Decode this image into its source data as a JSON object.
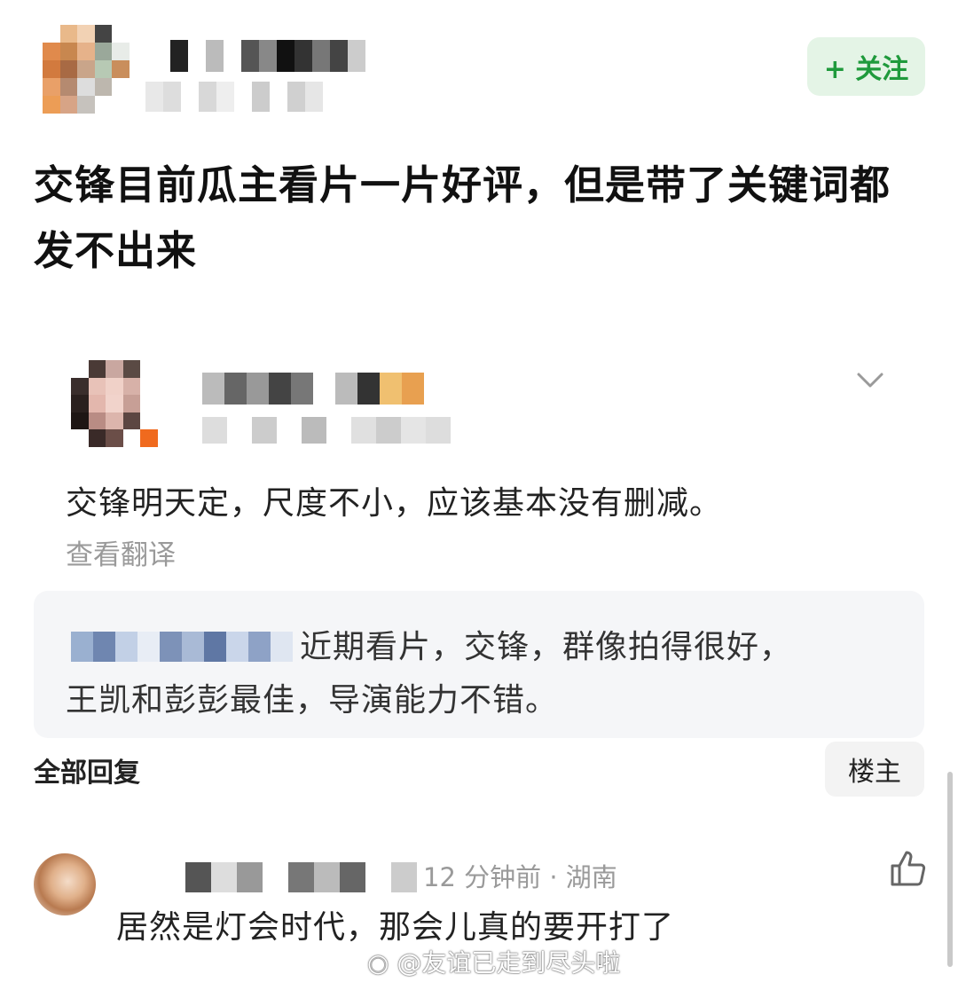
{
  "post": {
    "follow_label": "+ 关注",
    "title": "交锋目前瓜主看片一片好评，但是带了关键词都发不出来"
  },
  "reply": {
    "text": "交锋明天定，尺度不小，应该基本没有删减。",
    "translate_label": "查看翻译",
    "quote_line1": "近期看片，交锋，群像拍得很好，",
    "quote_line2": "王凯和彭彭最佳，导演能力不错。"
  },
  "replies_bar": {
    "all_replies_label": "全部回复",
    "op_label": "楼主"
  },
  "comment": {
    "meta": "12 分钟前 · 湖南",
    "text": "居然是灯会时代，那会儿真的要开打了"
  },
  "watermark": "@友谊已走到尽头啦",
  "colors": {
    "accent_green": "#1f9a3c",
    "follow_bg": "#e4f4e6",
    "quote_bg": "#f5f6f8",
    "muted_text": "#9a9a9a"
  },
  "icons": [
    "chevron-down-icon",
    "thumbs-up-icon",
    "weibo-icon"
  ]
}
